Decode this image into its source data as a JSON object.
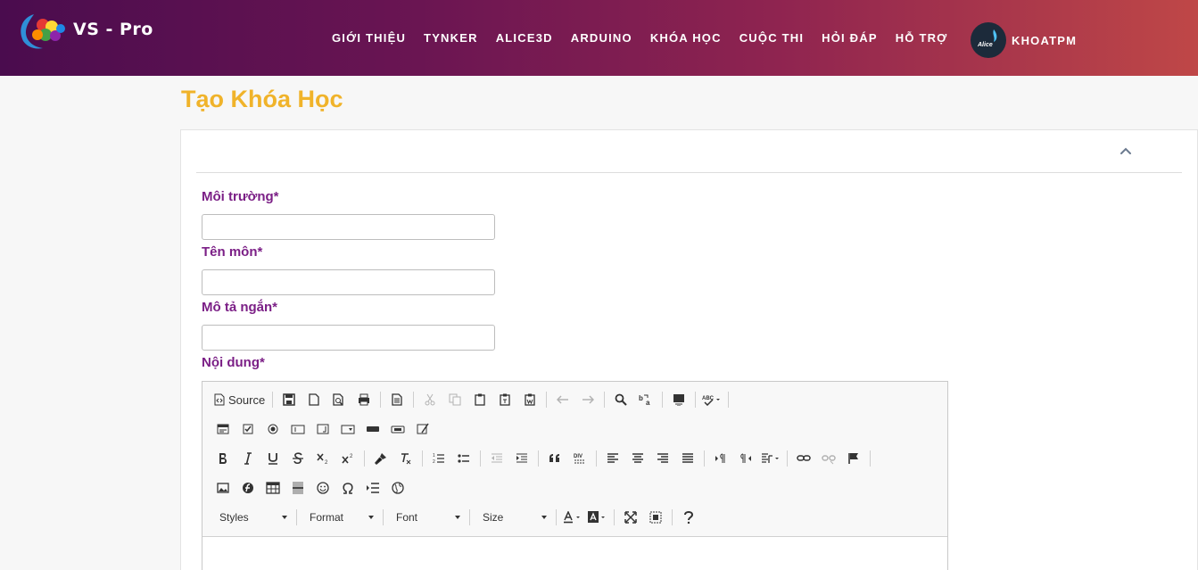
{
  "header": {
    "logo_text": "VS - Pro",
    "nav": [
      "GIỚI THIỆU",
      "TYNKER",
      "ALICE3D",
      "ARDUINO",
      "KHÓA HỌC",
      "CUỘC THI",
      "HỎI ĐÁP",
      "HỖ TRỢ"
    ],
    "user_name": "KHOATPM",
    "avatar_text": "Alice"
  },
  "page": {
    "title": "Tạo Khóa Học"
  },
  "form": {
    "fields": [
      {
        "label": "Môi trường*",
        "value": ""
      },
      {
        "label": "Tên môn*",
        "value": ""
      },
      {
        "label": "Mô tả ngắn*",
        "value": ""
      },
      {
        "label": "Nội dung*"
      }
    ]
  },
  "editor": {
    "source_label": "Source",
    "combos": [
      "Styles",
      "Format",
      "Font",
      "Size"
    ]
  },
  "colors": {
    "title": "#f0b32a",
    "label": "#7b1f86",
    "header_start": "#4a0c4e",
    "header_end": "#bf4747"
  }
}
